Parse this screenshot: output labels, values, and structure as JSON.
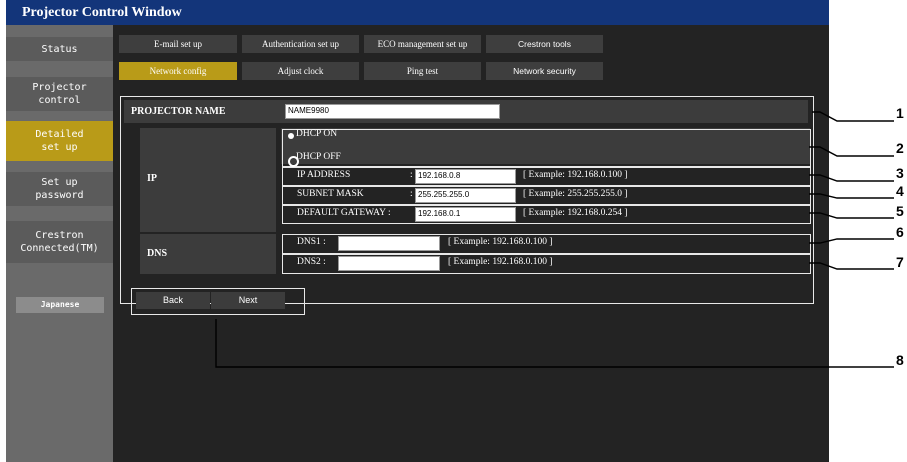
{
  "window": {
    "title": "Projector Control Window"
  },
  "sidebar": {
    "items": [
      {
        "label": "Status"
      },
      {
        "label": "Projector\ncontrol"
      },
      {
        "label": "Detailed\nset up"
      },
      {
        "label": "Set up\npassword"
      },
      {
        "label": "Crestron\nConnected(TM)"
      }
    ],
    "language_button": "Japanese"
  },
  "tabs": {
    "row1": [
      "E-mail set up",
      "Authentication set up",
      "ECO management set up",
      "Crestron tools"
    ],
    "row2": [
      "Network config",
      "Adjust clock",
      "Ping test",
      "Network security"
    ]
  },
  "form": {
    "projector_name_label": "PROJECTOR NAME",
    "projector_name_value": "NAME9980",
    "ip_label": "IP",
    "dhcp_on": "DHCP ON",
    "dhcp_off": "DHCP OFF",
    "ip_address_label": "IP ADDRESS",
    "ip_address_value": "192.168.0.8",
    "ip_address_example": "[ Example: 192.168.0.100 ]",
    "subnet_mask_label": "SUBNET MASK",
    "subnet_mask_value": "255.255.255.0",
    "subnet_mask_example": "[ Example: 255.255.255.0 ]",
    "gateway_label": "DEFAULT GATEWAY :",
    "gateway_value": "192.168.0.1",
    "gateway_example": "[ Example: 192.168.0.254 ]",
    "colon": ":",
    "dns_label": "DNS",
    "dns1_label": "DNS1 :",
    "dns1_value": "",
    "dns1_example": "[ Example: 192.168.0.100 ]",
    "dns2_label": "DNS2 :",
    "dns2_value": "",
    "dns2_example": "[ Example: 192.168.0.100 ]"
  },
  "buttons": {
    "back": "Back",
    "next": "Next"
  },
  "callouts": [
    "1",
    "2",
    "3",
    "4",
    "5",
    "6",
    "7",
    "8"
  ],
  "colors": {
    "title_bar": "#13357a",
    "active": "#b99b18",
    "sidebar": "#6a6a6a",
    "content": "#232323"
  }
}
